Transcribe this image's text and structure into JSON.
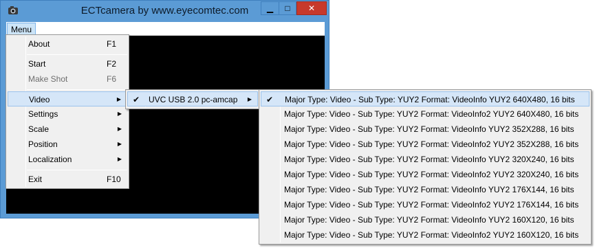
{
  "window": {
    "title": "ECTcamera by www.eyecomtec.com",
    "controls": {
      "minimize": "▁",
      "maximize": "□",
      "close": "✕"
    }
  },
  "menubar": {
    "menu_label": "Menu"
  },
  "main_menu": {
    "items": [
      {
        "label": "About",
        "accel": "F1"
      },
      {
        "label": "Start",
        "accel": "F2"
      },
      {
        "label": "Make Shot",
        "accel": "F6"
      },
      {
        "label": "Video",
        "arrow": "▶"
      },
      {
        "label": "Settings",
        "arrow": "▶"
      },
      {
        "label": "Scale",
        "arrow": "▶"
      },
      {
        "label": "Position",
        "arrow": "▶"
      },
      {
        "label": "Localization",
        "arrow": "▶"
      },
      {
        "label": "Exit",
        "accel": "F10"
      }
    ]
  },
  "video_menu": {
    "items": [
      {
        "label": "UVC USB 2.0 pc-amcap",
        "check": "✔",
        "arrow": "▶"
      }
    ]
  },
  "format_menu": {
    "check": "✔",
    "items": [
      "Major Type: Video - Sub Type: YUY2 Format: VideoInfo YUY2 640X480, 16 bits",
      "Major Type: Video - Sub Type: YUY2 Format: VideoInfo2 YUY2 640X480, 16 bits",
      "Major Type: Video - Sub Type: YUY2 Format: VideoInfo YUY2 352X288, 16 bits",
      "Major Type: Video - Sub Type: YUY2 Format: VideoInfo2 YUY2 352X288, 16 bits",
      "Major Type: Video - Sub Type: YUY2 Format: VideoInfo YUY2 320X240, 16 bits",
      "Major Type: Video - Sub Type: YUY2 Format: VideoInfo2 YUY2 320X240, 16 bits",
      "Major Type: Video - Sub Type: YUY2 Format: VideoInfo YUY2 176X144, 16 bits",
      "Major Type: Video - Sub Type: YUY2 Format: VideoInfo2 YUY2 176X144, 16 bits",
      "Major Type: Video - Sub Type: YUY2 Format: VideoInfo YUY2 160X120, 16 bits",
      "Major Type: Video - Sub Type: YUY2 Format: VideoInfo2 YUY2 160X120, 16 bits"
    ]
  },
  "colors": {
    "titlebar": "#5b9bd5",
    "highlight": "#d5e6f8",
    "close_button": "#c7392b",
    "video_area": "#000000"
  }
}
